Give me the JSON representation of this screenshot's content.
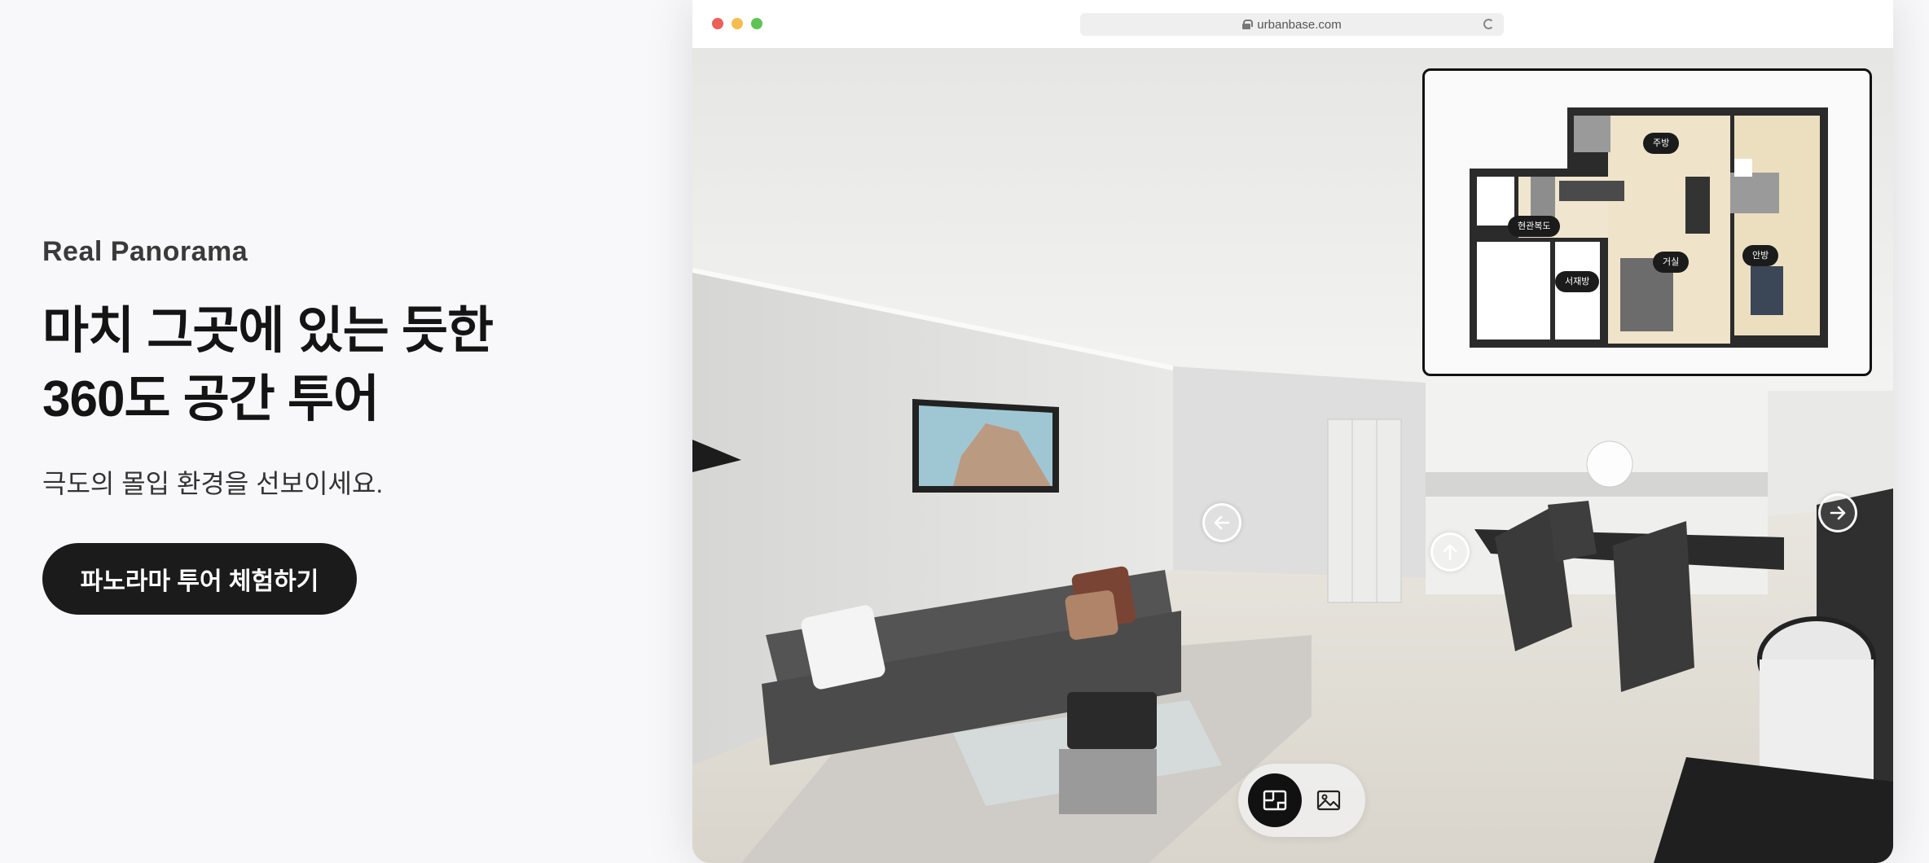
{
  "hero": {
    "eyebrow": "Real Panorama",
    "headline_line1": "마치 그곳에 있는 듯한",
    "headline_line2": "360도 공간 투어",
    "subcopy": "극도의 몰입 환경을 선보이세요.",
    "cta_label": "파노라마 투어 체험하기"
  },
  "browser": {
    "url": "urbanbase.com",
    "icons": {
      "lock": "lock-icon",
      "reload": "reload-icon"
    }
  },
  "panorama": {
    "nav_icons": [
      "arrow-left-icon",
      "arrow-up-icon",
      "arrow-right-icon"
    ],
    "floorplan": {
      "rooms": {
        "kitchen": "주방",
        "entrance": "현관복도",
        "living": "거실",
        "master": "안방",
        "study": "서재방"
      }
    },
    "toolbar": {
      "buttons": [
        "floorplan-icon",
        "image-icon"
      ],
      "active": "floorplan-icon"
    }
  },
  "colors": {
    "background": "#f8f8fa",
    "cta_background": "#1b1b1b",
    "cta_text": "#ffffff",
    "traffic_red": "#ee5f57",
    "traffic_yellow": "#f5bd4f",
    "traffic_green": "#60c454"
  }
}
